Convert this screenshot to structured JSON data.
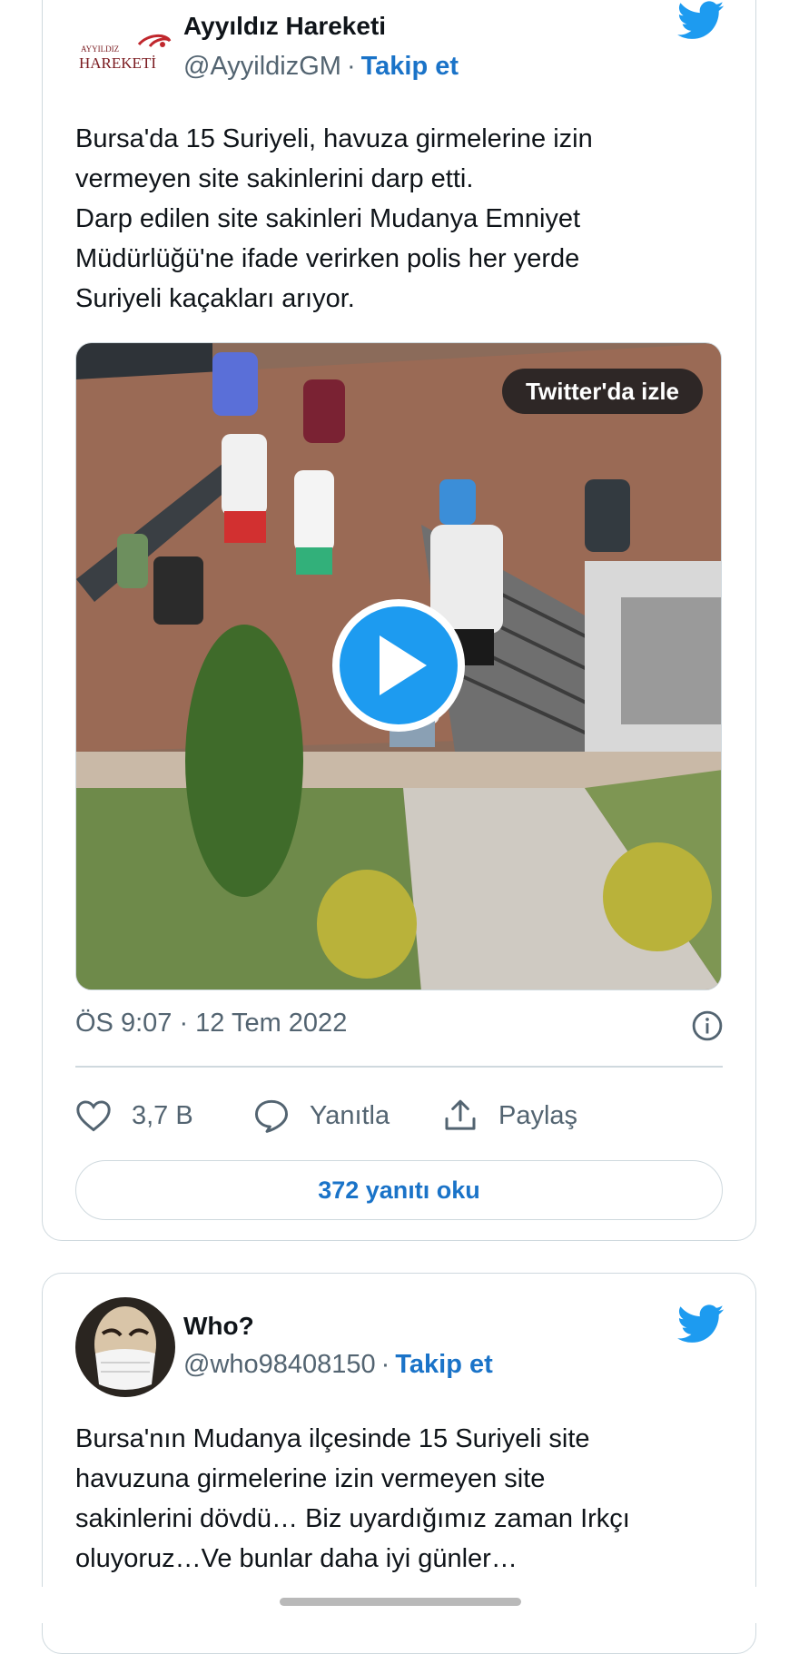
{
  "colors": {
    "accent": "#1d9bf0",
    "link": "#1a73c8",
    "muted": "#536471",
    "border": "#cfd9de"
  },
  "tweets": [
    {
      "avatar_icon": "ayyildiz-hareketi-logo",
      "avatar_logo_text_top": "AYYILDIZ",
      "avatar_logo_text_bottom": "HAREKETİ",
      "name": "Ayyıldız Hareketi",
      "handle": "@AyyildizGM",
      "separator": "·",
      "follow_label": "Takip et",
      "text_lines": [
        "Bursa'da 15 Suriyeli, havuza girmelerine izin",
        "vermeyen site sakinlerini darp etti.",
        "Darp edilen site sakinleri Mudanya Emniyet",
        "Müdürlüğü'ne ifade verirken polis her yerde",
        "Suriyeli kaçakları arıyor."
      ],
      "media": {
        "watch_label": "Twitter'da izle",
        "play_icon": "play-icon"
      },
      "timestamp": "ÖS 9:07 · 12 Tem 2022",
      "likes": "3,7 B",
      "reply_label": "Yanıtla",
      "share_label": "Paylaş",
      "read_replies_label": "372 yanıtı oku"
    },
    {
      "avatar_icon": "masked-person-avatar",
      "name": "Who?",
      "handle": "@who98408150",
      "separator": "·",
      "follow_label": "Takip et",
      "text_lines": [
        "Bursa'nın Mudanya ilçesinde 15 Suriyeli site",
        "havuzuna girmelerine izin vermeyen  site",
        "sakinlerini dövdü… Biz uyardığımız zaman Irkçı",
        "oluyoruz…Ve bunlar daha iyi günler…"
      ]
    }
  ]
}
